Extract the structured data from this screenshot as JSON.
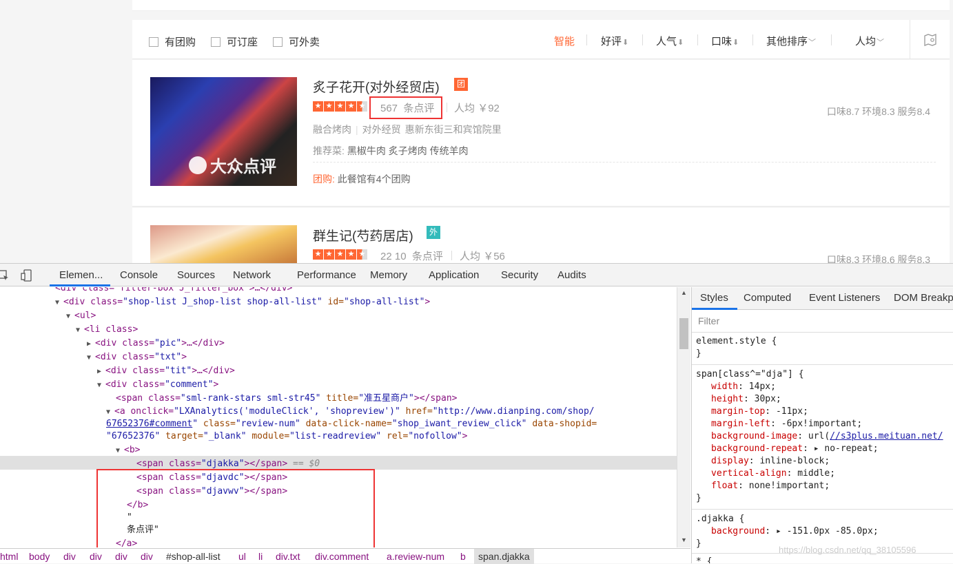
{
  "filters": {
    "checkboxes": [
      "有团购",
      "可订座",
      "可外卖"
    ],
    "sorts": [
      {
        "label": "智能",
        "arrow": "",
        "active": true
      },
      {
        "label": "好评",
        "arrow": "⬇"
      },
      {
        "label": "人气",
        "arrow": "⬇"
      },
      {
        "label": "口味",
        "arrow": "⬇"
      },
      {
        "label": "其他排序",
        "arrow": "﹀"
      },
      {
        "label": "人均",
        "arrow": "﹀"
      }
    ]
  },
  "shops": [
    {
      "name": "炙子花开(对外经贸店)",
      "tag": "团",
      "review_count": "567",
      "review_unit": "条点评",
      "avg_label": "人均",
      "avg_price": "￥92",
      "scores": "口味8.7   环境8.3   服务8.4",
      "cuisine": "融合烤肉",
      "area": "对外经贸",
      "address": "惠新东街三和宾馆院里",
      "rec_label": "推荐菜:",
      "dishes": "黑椒牛肉 炙子烤肉 传统羊肉",
      "group_label": "团购:",
      "group_text": "此餐馆有4个团购",
      "watermark": "大众点评"
    },
    {
      "name": "群生记(芍药居店)",
      "tag": "外",
      "review_count": "22 10",
      "review_unit": "条点评",
      "avg_label": "人均",
      "avg_price": "￥56",
      "scores": "口味8.3   环境8.6   服务8.3"
    }
  ],
  "devtools": {
    "tabs": [
      "Elemen...",
      "Console",
      "Sources",
      "Network",
      "Performance",
      "Memory",
      "Application",
      "Security",
      "Audits"
    ],
    "styles_tabs": [
      "Styles",
      "Computed",
      "Event Listeners",
      "DOM Breakpo"
    ],
    "filter_placeholder": "Filter",
    "breadcrumbs": [
      "html",
      "body",
      "div",
      "div",
      "div",
      "div",
      "#shop-all-list",
      "ul",
      "li",
      "div.txt",
      "div.comment",
      "a.review-num",
      "b",
      "span.djakka"
    ],
    "dom": {
      "l0": "<div class=\"filter-box J_filter_box\">…</div>",
      "l1a": "<div class=",
      "l1b": "\"shop-list J_shop-list shop-all-list\"",
      "l1c": " id=",
      "l1d": "\"shop-all-list\"",
      "l1e": ">",
      "l2": "<ul>",
      "l3": "<li class>",
      "l4a": "<div class=",
      "l4b": "\"pic\"",
      "l4c": ">…</div>",
      "l5a": "<div class=",
      "l5b": "\"txt\"",
      "l5c": ">",
      "l6a": "<div class=",
      "l6b": "\"tit\"",
      "l6c": ">…</div>",
      "l7a": "<div class=",
      "l7b": "\"comment\"",
      "l7c": ">",
      "l8a": "<span class=",
      "l8b": "\"sml-rank-stars sml-str45\"",
      "l8c": " title=",
      "l8d": "\"准五星商户\"",
      "l8e": "></span>",
      "l9a": "<a onclick=",
      "l9b": "\"LXAnalytics('moduleClick', 'shopreview')\"",
      "l9c": " href=",
      "l9d": "\"http://www.dianping.com/shop/",
      "l10a": "67652376#comment",
      "l10b": "\"",
      "l10c": " class=",
      "l10d": "\"review-num\"",
      "l10e": " data-click-name=",
      "l10f": "\"shop_iwant_review_click\"",
      "l10g": " data-shopid=",
      "l11a": "\"67652376\"",
      "l11b": " target=",
      "l11c": "\"_blank\"",
      "l11d": " module=",
      "l11e": "\"list-readreview\"",
      "l11f": " rel=",
      "l11g": "\"nofollow\"",
      "l11h": ">",
      "l12": "<b>",
      "l13a": "<span class=",
      "l13b": "\"djakka\"",
      "l13c": "></span>",
      "l13d": " == $0",
      "l14a": "<span class=",
      "l14b": "\"djavdc\"",
      "l14c": "></span>",
      "l15a": "<span class=",
      "l15b": "\"djavwv\"",
      "l15c": "></span>",
      "l16": "</b>",
      "l17": "\"",
      "l18": "条点评\"",
      "l19": "</a>"
    },
    "css": {
      "r1": "element.style {",
      "r1e": "}",
      "r2": "span[class^=\"dja\"] {",
      "p1": "width",
      "v1": "14px;",
      "p2": "height",
      "v2": "30px;",
      "p3": "margin-top",
      "v3": "-11px;",
      "p4": "margin-left",
      "v4": "-6px!important;",
      "p5": "background-image",
      "v5a": "url(",
      "v5b": "//s3plus.meituan.net/",
      "p6": "background-repeat",
      "v6": "▸ no-repeat;",
      "p7": "display",
      "v7": "inline-block;",
      "p8": "vertical-align",
      "v8": "middle;",
      "p9": "float",
      "v9": "none!important;",
      "r2e": "}",
      "r3": ".djakka {",
      "p10": "background",
      "v10": "▸ -151.0px -85.0px;",
      "r3e": "}",
      "r4": "* {"
    },
    "watermark": "https://blog.csdn.net/qq_38105596"
  }
}
